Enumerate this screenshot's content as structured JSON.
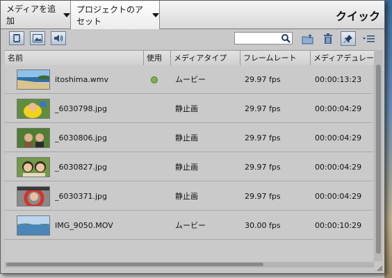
{
  "topbar": {
    "add_media": "メディアを追加",
    "project_assets": "プロジェクトのアセット",
    "quick": "クイック"
  },
  "toolbar": {
    "filter_video_icon": "film-icon",
    "filter_image_icon": "image-icon",
    "filter_audio_icon": "speaker-icon",
    "search_value": "",
    "search_icon": "search-icon"
  },
  "columns": [
    "名前",
    "使用",
    "メディアタイプ",
    "フレームレート",
    "メディアデュレーシ"
  ],
  "rows": [
    {
      "name": "itoshima.wmv",
      "used": true,
      "type": "ムービー",
      "fps": "29.97 fps",
      "duration": "00:00:13:23",
      "thumb": "beach"
    },
    {
      "name": "_6030798.jpg",
      "used": false,
      "type": "静止画",
      "fps": "29.97 fps",
      "duration": "00:00:04:29",
      "thumb": "child-yellow"
    },
    {
      "name": "_6030806.jpg",
      "used": false,
      "type": "静止画",
      "fps": "29.97 fps",
      "duration": "00:00:04:29",
      "thumb": "children-green"
    },
    {
      "name": "_6030827.jpg",
      "used": false,
      "type": "静止画",
      "fps": "29.97 fps",
      "duration": "00:00:04:29",
      "thumb": "children-faces"
    },
    {
      "name": "_6030371.jpg",
      "used": false,
      "type": "静止画",
      "fps": "29.97 fps",
      "duration": "00:00:04:29",
      "thumb": "child-red-ring"
    },
    {
      "name": "IMG_9050.MOV",
      "used": false,
      "type": "ムービー",
      "fps": "30.00 fps",
      "duration": "00:00:10:29",
      "thumb": "sea"
    }
  ],
  "colors": {
    "used_dot": "#7fb04b",
    "row_bg": "#cacaca"
  }
}
